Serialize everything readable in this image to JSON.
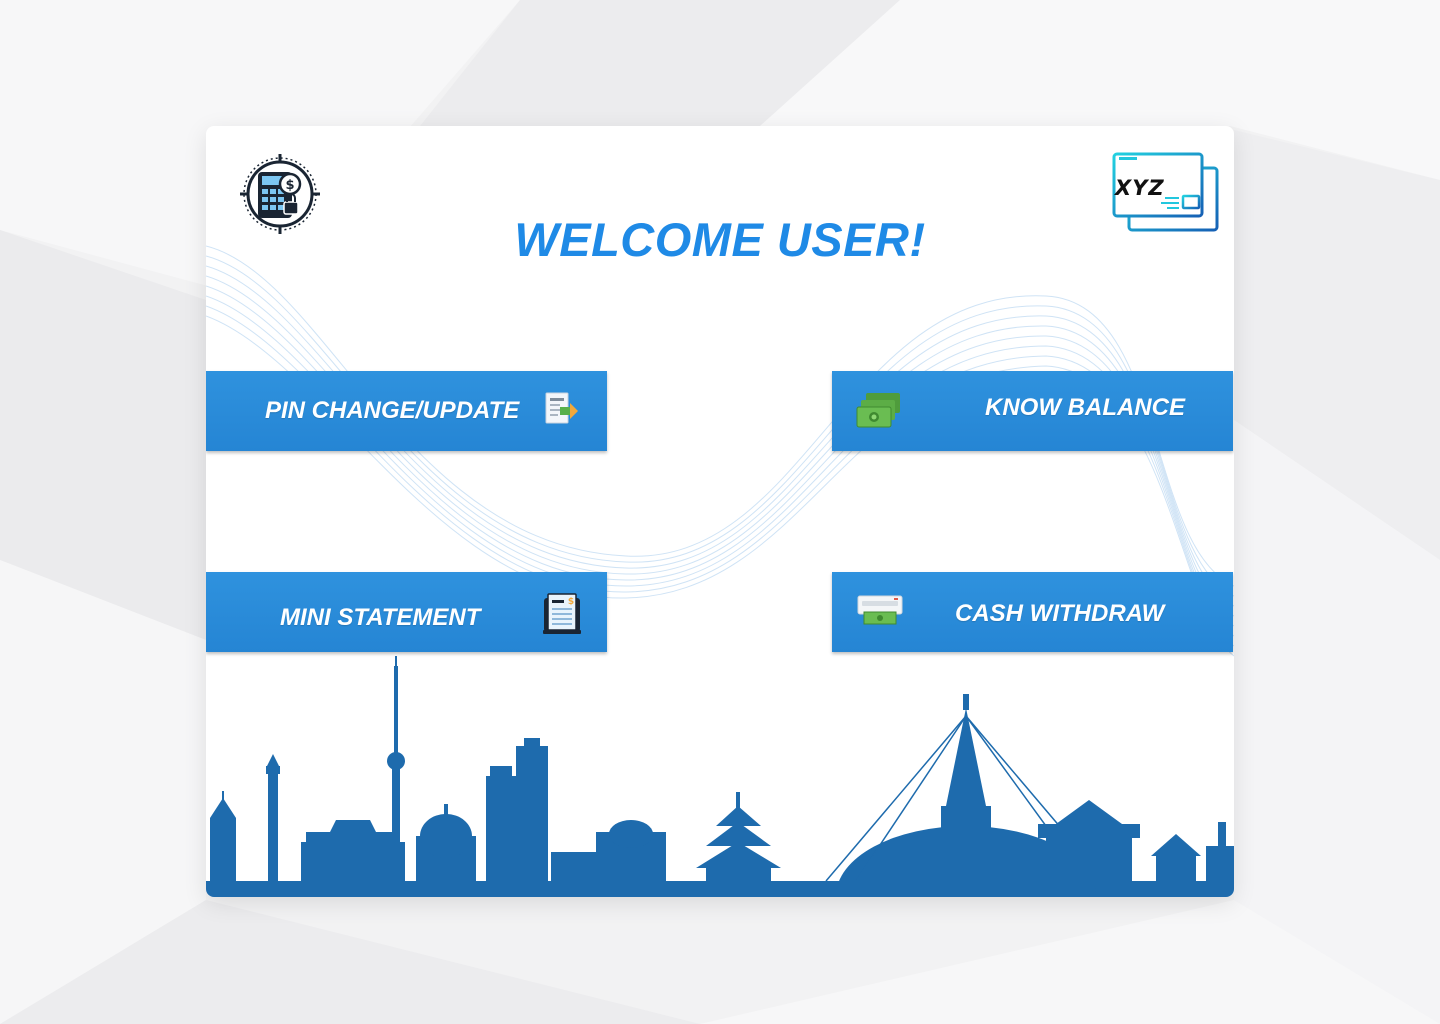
{
  "header": {
    "brand_logo_icon": "atm-calculator-icon",
    "xyz_logo_icon": "card-window-icon",
    "xyz_label": "XYZ",
    "title": "WELCOME USER!"
  },
  "menu": {
    "items": [
      {
        "id": "pin",
        "label": "PIN CHANGE/UPDATE",
        "icon": "pin-document-icon"
      },
      {
        "id": "balance",
        "label": "KNOW BALANCE",
        "icon": "cash-stack-icon"
      },
      {
        "id": "mini",
        "label": "MINI STATEMENT",
        "icon": "statement-receipt-icon"
      },
      {
        "id": "cash",
        "label": "CASH WITHDRAW",
        "icon": "cash-dispense-icon"
      }
    ]
  },
  "footer": {
    "skyline": "city-skyline-illustration"
  },
  "colors": {
    "accent": "#1f8ae6",
    "button": "#2a8ad8",
    "skyline": "#1e6bad",
    "panel": "#ffffff",
    "background": "#f2f2f3"
  }
}
